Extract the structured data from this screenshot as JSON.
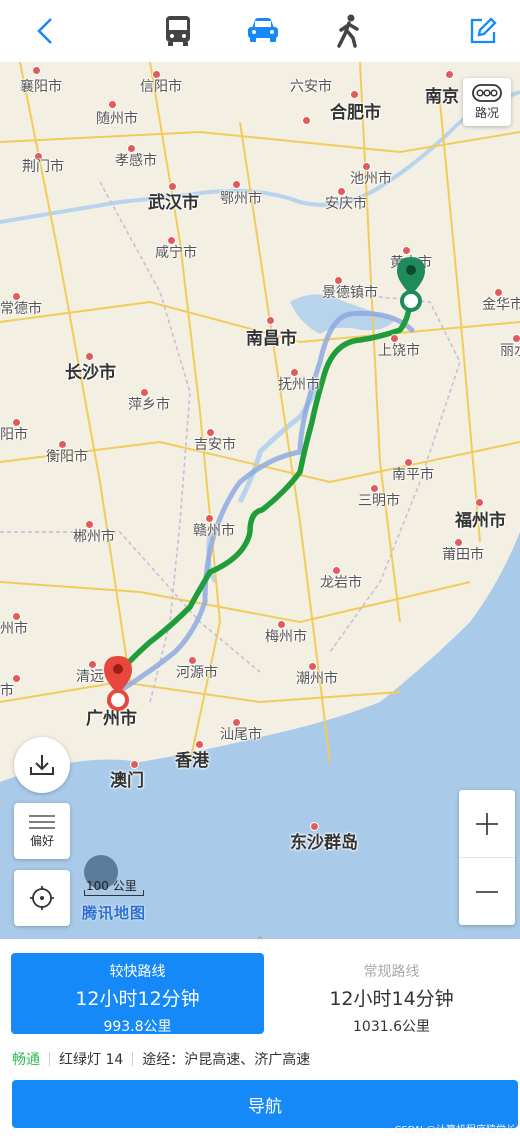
{
  "topbar": {
    "back_icon": "chevron-left-icon",
    "modes": [
      "bus-icon",
      "car-icon",
      "walk-icon"
    ],
    "active_mode": "car-icon",
    "edit_icon": "edit-icon",
    "colors": {
      "accent": "#1589f8",
      "inactive": "#444444"
    }
  },
  "map": {
    "cities": [
      {
        "name": "襄阳市",
        "big": false
      },
      {
        "name": "信阳市",
        "big": false
      },
      {
        "name": "六安市",
        "big": false
      },
      {
        "name": "合肥市",
        "big": true
      },
      {
        "name": "南京",
        "big": true
      },
      {
        "name": "随州市",
        "big": false
      },
      {
        "name": "荆门市",
        "big": false
      },
      {
        "name": "孝感市",
        "big": false
      },
      {
        "name": "武汉市",
        "big": true
      },
      {
        "name": "鄂州市",
        "big": false
      },
      {
        "name": "池州市",
        "big": false
      },
      {
        "name": "安庆市",
        "big": false
      },
      {
        "name": "咸宁市",
        "big": false
      },
      {
        "name": "黄山市",
        "big": false
      },
      {
        "name": "景德镇市",
        "big": false
      },
      {
        "name": "金华市",
        "big": false
      },
      {
        "name": "常德市",
        "big": false
      },
      {
        "name": "南昌市",
        "big": true
      },
      {
        "name": "上饶市",
        "big": false
      },
      {
        "name": "丽水",
        "big": false
      },
      {
        "name": "长沙市",
        "big": true
      },
      {
        "name": "抚州市",
        "big": false
      },
      {
        "name": "萍乡市",
        "big": false
      },
      {
        "name": "阳市",
        "big": false
      },
      {
        "name": "衡阳市",
        "big": false
      },
      {
        "name": "吉安市",
        "big": false
      },
      {
        "name": "南平市",
        "big": false
      },
      {
        "name": "三明市",
        "big": false
      },
      {
        "name": "福州市",
        "big": true
      },
      {
        "name": "郴州市",
        "big": false
      },
      {
        "name": "赣州市",
        "big": false
      },
      {
        "name": "莆田市",
        "big": false
      },
      {
        "name": "龙岩市",
        "big": false
      },
      {
        "name": "州市",
        "big": false
      },
      {
        "name": "梅州市",
        "big": false
      },
      {
        "name": "清远",
        "big": false
      },
      {
        "name": "河源市",
        "big": false
      },
      {
        "name": "潮州市",
        "big": false
      },
      {
        "name": "市",
        "big": false
      },
      {
        "name": "广州市",
        "big": true
      },
      {
        "name": "汕尾市",
        "big": false
      },
      {
        "name": "香港",
        "big": true
      },
      {
        "name": "澳门",
        "big": true
      },
      {
        "name": "东沙群岛",
        "big": true
      }
    ],
    "traffic_button": {
      "icon": "traffic-icon",
      "label": "路况"
    },
    "download_icon": "download-icon",
    "preference": {
      "icon": "menu-lines-icon",
      "label": "偏好"
    },
    "locate_icon": "locate-icon",
    "zoom_in_icon": "plus-icon",
    "zoom_out_icon": "minus-icon",
    "scale_label": "100 公里",
    "watermark": "腾讯地图",
    "start_marker": "start-pin-icon",
    "end_marker": "end-pin-icon"
  },
  "panel": {
    "expand_icon": "chevron-up-icon",
    "routes": [
      {
        "name": "较快路线",
        "time": "12小时12分钟",
        "distance": "993.8公里",
        "active": true
      },
      {
        "name": "常规路线",
        "time": "12小时14分钟",
        "distance": "1031.6公里",
        "active": false
      }
    ],
    "traffic_status": "畅通",
    "traffic_lights": "红绿灯 14",
    "via": "途经：沪昆高速、济广高速",
    "navigate_label": "导航",
    "watermark": "CSDN @计算机程序猿学长"
  }
}
